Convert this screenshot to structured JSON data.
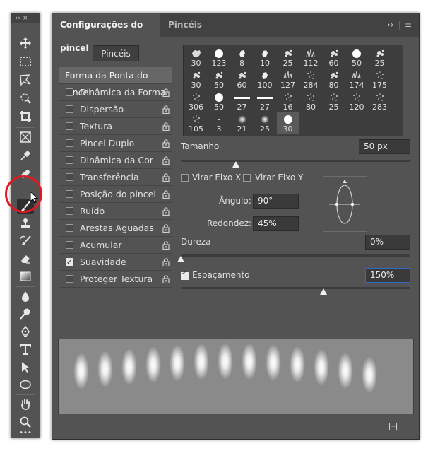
{
  "toolbar": {
    "collapse_label": "›› ×",
    "tools": [
      "move-tool",
      "marquee-tool",
      "lasso-tool",
      "quick-selection-tool",
      "crop-tool",
      "frame-tool",
      "eyedropper-tool",
      "spot-healing-tool",
      "brush-tool",
      "clone-stamp-tool",
      "history-brush-tool",
      "eraser-tool",
      "gradient-tool",
      "blur-tool",
      "dodge-tool",
      "pen-tool",
      "type-tool",
      "path-selection-tool",
      "ellipse-tool",
      "hand-tool",
      "zoom-tool",
      "more-tools"
    ],
    "active_tool": "brush-tool",
    "more_label": "•••"
  },
  "panel": {
    "tab_active": "Configurações do pincel",
    "tab_inactive": "Pincéis",
    "tab_controls": "››",
    "menu_icon": "≡",
    "brushes_button": "Pincéis",
    "options": [
      {
        "label": "Forma da Ponta do Pincel",
        "header": true
      },
      {
        "label": "Dinâmica da Forma",
        "checked": false,
        "lock": true
      },
      {
        "label": "Dispersão",
        "checked": false,
        "lock": true
      },
      {
        "label": "Textura",
        "checked": false,
        "lock": true
      },
      {
        "label": "Pincel Duplo",
        "checked": false,
        "lock": true
      },
      {
        "label": "Dinâmica da Cor",
        "checked": false,
        "lock": true
      },
      {
        "label": "Transferência",
        "checked": false,
        "lock": true
      },
      {
        "label": "Posição do pincel",
        "checked": false,
        "lock": true
      },
      {
        "label": "Ruído",
        "checked": false,
        "lock": true
      },
      {
        "label": "Arestas Aguadas",
        "checked": false,
        "lock": true
      },
      {
        "label": "Acumular",
        "checked": false,
        "lock": true
      },
      {
        "label": "Suavidade",
        "checked": true,
        "lock": true
      },
      {
        "label": "Proteger Textura",
        "checked": false,
        "lock": true
      }
    ],
    "presets": [
      {
        "size": "30",
        "shape": "rough"
      },
      {
        "size": "123",
        "shape": "round"
      },
      {
        "size": "8",
        "shape": "splat"
      },
      {
        "size": "10",
        "shape": "splat"
      },
      {
        "size": "25",
        "shape": "splatter"
      },
      {
        "size": "112",
        "shape": "grass"
      },
      {
        "size": "60",
        "shape": "splatter"
      },
      {
        "size": "50",
        "shape": "round"
      },
      {
        "size": "25",
        "shape": "splatter"
      },
      {
        "size": "30",
        "shape": "splatter"
      },
      {
        "size": "50",
        "shape": "splatter"
      },
      {
        "size": "60",
        "shape": "splatter"
      },
      {
        "size": "100",
        "shape": "splat"
      },
      {
        "size": "127",
        "shape": "grass"
      },
      {
        "size": "284",
        "shape": "dots"
      },
      {
        "size": "80",
        "shape": "splatter"
      },
      {
        "size": "174",
        "shape": "grass"
      },
      {
        "size": "175",
        "shape": "dots"
      },
      {
        "size": "306",
        "shape": "dots"
      },
      {
        "size": "50",
        "shape": "round"
      },
      {
        "size": "27",
        "shape": "line"
      },
      {
        "size": "27",
        "shape": "line"
      },
      {
        "size": "16",
        "shape": "dots"
      },
      {
        "size": "80",
        "shape": "dots"
      },
      {
        "size": "25",
        "shape": "dots"
      },
      {
        "size": "120",
        "shape": "dots"
      },
      {
        "size": "283",
        "shape": "dots"
      },
      {
        "size": "105",
        "shape": "dots"
      },
      {
        "size": "3",
        "shape": "tiny"
      },
      {
        "size": "21",
        "shape": "soft"
      },
      {
        "size": "25",
        "shape": "soft"
      },
      {
        "size": "30",
        "shape": "round-selected"
      }
    ],
    "size_label": "Tamanho",
    "size_value": "50 px",
    "size_slider": 0.24,
    "flip_x_label": "Virar Eixo X",
    "flip_y_label": "Virar Eixo Y",
    "angle_label": "Ângulo:",
    "angle_value": "90°",
    "roundness_label": "Redondez:",
    "roundness_value": "45%",
    "hardness_label": "Dureza",
    "hardness_value": "0%",
    "hardness_slider": 0,
    "spacing_label": "Espaçamento",
    "spacing_checked": true,
    "spacing_value": "150%",
    "spacing_slider": 0.62,
    "new_brush_icon": "+",
    "colors": {
      "panel": "#535353",
      "tab_bar": "#424242",
      "highlight_circle": "#e01a22",
      "focus_border": "#2f6bc2"
    }
  }
}
